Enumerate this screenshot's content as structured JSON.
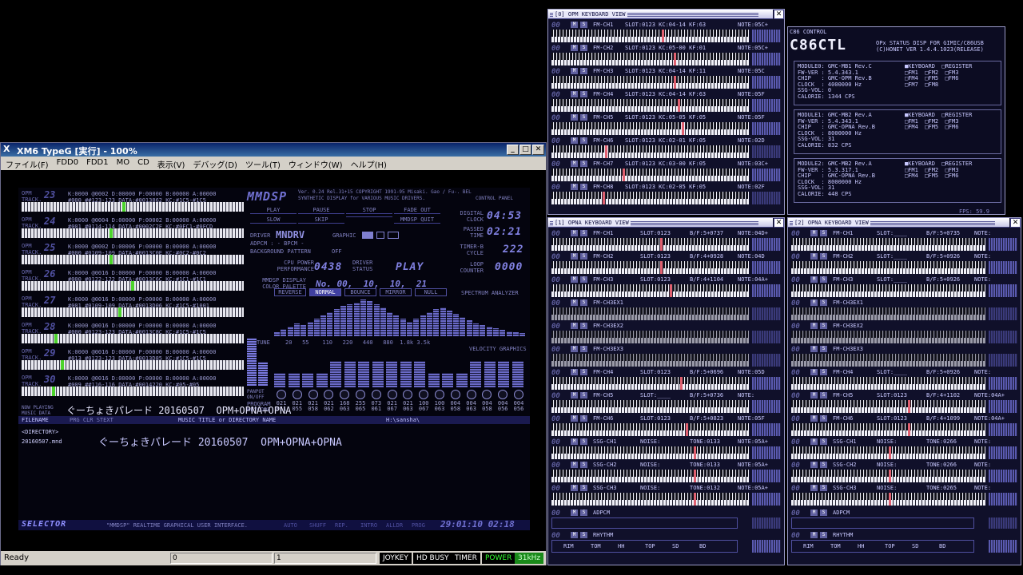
{
  "xm6": {
    "title": "XM6 TypeG [実行] - 100%",
    "logo": "Χ",
    "menu": [
      "ファイル(F)",
      "FDD0",
      "FDD1",
      "MO",
      "CD",
      "表示(V)",
      "デバッグ(D)",
      "ツール(T)",
      "ウィンドウ(W)",
      "ヘルプ(H)"
    ],
    "status": {
      "ready": "Ready",
      "fdd0": "0",
      "fdd1": "1",
      "joykey": "JOYKEY",
      "hdbusy": "HD BUSY",
      "timer": "TIMER",
      "power": "POWER",
      "clock": "31kHz"
    }
  },
  "mmdsp": {
    "logo": "MMDSP",
    "version": "Ver. 0.24 Rel.31+15 COPYRIGHT 1991-95 Misaki. Gao / Fu-. BEL",
    "subtitle": "SYNTHETIC DISPLAY for VARIOUS MUSIC DRIVERS.",
    "control_panel": "CONTROL PANEL",
    "buttons": [
      "PLAY",
      "PAUSE",
      "STOP",
      "FADE OUT",
      "SLOW",
      "SKIP",
      "",
      "MMDSP QUIT"
    ],
    "driver_label": "DRIVER",
    "driver": "MNDRV",
    "graphic": "GRAPHIC",
    "adpcm": "ADPCM : - BPCM -",
    "bg": "BACKGROUND PATTERN",
    "bg_val": "OFF",
    "cpu_label": "CPU POWER PERFORMANCE",
    "cpu": "0438",
    "status_label": "DRIVER STATUS",
    "status": "PLAY",
    "palette_label": "MMDSP DISPLAY COLOR PALETTE",
    "palette": "No. 00,  10,  10,  21",
    "digital_clock_label": "DIGITAL CLOCK",
    "digital_clock": "04:53",
    "passed_label": "PASSED TIME",
    "passed": "02:21",
    "timerb_label": "TIMER-B CYCLE",
    "timerb": "222",
    "loop_label": "LOOP COUNTER",
    "loop": "0000",
    "tracks": [
      {
        "n": "23",
        "type": "OPM",
        "info": "K:0000 @0002 D:00000 P:00000 B:00000 A:00000\n#000 ##123-123 DATA:#0013862 KC:#1C5-#1C5",
        "key": 46,
        "dim": false
      },
      {
        "n": "24",
        "type": "OPM",
        "info": "K:0000 @0004 D:00000 P:00002 B:00000 A:00000\n#001 #0114-114 DATA:#0002C2F KC:#0FC1-#0FCD",
        "key": 40,
        "dim": false
      },
      {
        "n": "25",
        "type": "OPM",
        "info": "K:0000 @0002 D:00006 P:00000 B:00000 A:00000\n#000 #0109-109 DATA:#0013C0E KC:#0C2-#0C2",
        "key": 40,
        "dim": false
      },
      {
        "n": "26",
        "type": "OPM",
        "info": "K:0000 @0016 D:00000 P:00000 B:00000 A:00000\n#000 #0122-122 DATA:#0013C6C KC:#1C1-#1C1",
        "key": 50,
        "dim": false
      },
      {
        "n": "27",
        "type": "OPM",
        "info": "K:0000 @0016 D:00000 P:00000 B:00000 A:00000\n#001 #0109-109 DATA:#0013D06 KC:#1C5-#1001",
        "key": 44,
        "dim": false
      },
      {
        "n": "28",
        "type": "OPM",
        "info": "K:0000 @0016 D:00000 P:00000 B:00000 A:00000\n#000 #0123-123 DATA:#0013C8C KC:#1C5-#1C5",
        "key": 15,
        "dim": false
      },
      {
        "n": "29",
        "type": "OPM",
        "info": "K:0000 @0016 D:00000 P:00000 B:00000 A:00000\n#013 #0123-123 DATA:#0013D85 KC:#1C5-#1C5",
        "key": 18,
        "dim": false
      },
      {
        "n": "30",
        "type": "OPM",
        "info": "K:0000 @0016 D:00000 P:00000 B:00000 A:00000\n#009 ##116-116 DATA:#0014220 KC:#05-#05",
        "key": 14,
        "dim": false
      }
    ],
    "spectrum_title": "SPECTRUM ANALYZER",
    "spec_tabs": [
      "REVERSE",
      "NORMAL",
      "BOUNCE",
      "MIRROR",
      "NULL"
    ],
    "spectrum": [
      5,
      9,
      12,
      16,
      14,
      18,
      22,
      26,
      30,
      34,
      38,
      40,
      42,
      46,
      44,
      40,
      36,
      30,
      26,
      22,
      18,
      22,
      26,
      30,
      34,
      36,
      32,
      28,
      24,
      20,
      16,
      14,
      12,
      10,
      8,
      6,
      5,
      4
    ],
    "tune_label": "TUNE",
    "tune_ticks": "20   55    110   220   440   880  1.8k 3.5k",
    "velocity_title": "VELOCITY GRAPHICS",
    "velocity": [
      40,
      40,
      40,
      40,
      75,
      75,
      75,
      75,
      75,
      75,
      75,
      40,
      40,
      40,
      75,
      75,
      75,
      75
    ],
    "panpot_label": "PANPOT ON/OFF",
    "program_label": "PROGRAM",
    "keycode_label": "KEYCODE",
    "program": [
      "021",
      "021",
      "021",
      "021",
      "168",
      "255",
      "073",
      "021",
      "021",
      "100",
      "100",
      "004",
      "004",
      "004",
      "004",
      "004"
    ],
    "keycode": [
      "051",
      "055",
      "058",
      "062",
      "063",
      "065",
      "061",
      "067",
      "063",
      "067",
      "063",
      "058",
      "063",
      "058",
      "056",
      "056"
    ],
    "now_label": "NOW PLAYING MUSIC DATA",
    "now": "ぐーちょきパレード 20160507  OPM+OPNA+OPNA",
    "sel_header": [
      "FILENAME",
      "PRG CLR STEXT",
      "MUSIC TITLE or DIRECTORY NAME",
      "H:\\sansha\\"
    ],
    "dir": "<DIRECTORY>",
    "file": "20160507.mnd",
    "file_title": "ぐーちょきパレード 20160507  OPM+OPNA+OPNA",
    "selector": "SELECTOR",
    "selector_desc": "\"MMDSP\" REALTIME GRAPHICAL USER INTERFACE.",
    "sel_flags": [
      "AUTO",
      "SHUFF",
      "REP.",
      "INTRO",
      "ALLDR",
      "PROG"
    ],
    "sel_clock": "29:01:10 02:18"
  },
  "opm_view": {
    "title": "[0] OPM KEYBOARD VIEW",
    "channels": [
      {
        "n": "00",
        "name": "FM-CH1",
        "info": "SLOT:0123 KC:04-14 KF:63",
        "note": "NOTE:05C+",
        "hl": [
          0.56
        ],
        "meter": "high"
      },
      {
        "n": "00",
        "name": "FM-CH2",
        "info": "SLOT:0123 KC:05-00 KF:01",
        "note": "NOTE:05C+",
        "hl": [
          0.62
        ],
        "meter": "high"
      },
      {
        "n": "00",
        "name": "FM-CH3",
        "info": "SLOT:0123 KC:04-14 KF:11",
        "note": "NOTE:05C",
        "hl": [
          0.62
        ],
        "meter": "high"
      },
      {
        "n": "00",
        "name": "FM-CH4",
        "info": "SLOT:0123 KC:04-14 KF:63",
        "note": "NOTE:05F",
        "hl": [
          0.64
        ],
        "meter": "high"
      },
      {
        "n": "00",
        "name": "FM-CH5",
        "info": "SLOT:0123 KC:05-05 KF:05",
        "note": "NOTE:05F",
        "hl": [
          0.66
        ],
        "meter": "high"
      },
      {
        "n": "00",
        "name": "FM-CH6",
        "info": "SLOT:0123 KC:02-01 KF:05",
        "note": "NOTE:02D",
        "hl": [
          0.27
        ],
        "meter": "low"
      },
      {
        "n": "00",
        "name": "FM-CH7",
        "info": "SLOT:0123 KC:03-00 KF:05",
        "note": "NOTE:03C+",
        "hl": [
          0.36
        ],
        "meter": "high"
      },
      {
        "n": "00",
        "name": "FM-CH8",
        "info": "SLOT:0123 KC:02-05 KF:05",
        "note": "NOTE:02F",
        "hl": [
          0.26
        ],
        "meter": "low"
      }
    ]
  },
  "opna1": {
    "title": "[1] OPNA KEYBOARD VIEW",
    "channels": [
      {
        "name": "FM-CH1",
        "info": "SLOT:0123",
        "bf": "B/F:5+0737",
        "note": "NOTE:04D+",
        "hl": [
          0.55
        ],
        "dim": false
      },
      {
        "name": "FM-CH2",
        "info": "SLOT:0123",
        "bf": "B/F:4+0928",
        "note": "NOTE:04D",
        "hl": [
          0.55
        ],
        "dim": false
      },
      {
        "name": "FM-CH3",
        "info": "SLOT:0123",
        "bf": "B/F:4+1104",
        "note": "NOTE:04A+",
        "hl": [
          0.6
        ],
        "dim": false
      },
      {
        "name": "FM-CH3EX1",
        "info": "",
        "bf": "",
        "note": "",
        "hl": [],
        "dim": true
      },
      {
        "name": "FM-CH3EX2",
        "info": "",
        "bf": "",
        "note": "",
        "hl": [],
        "dim": true
      },
      {
        "name": "FM-CH3EX3",
        "info": "",
        "bf": "",
        "note": "",
        "hl": [],
        "dim": true
      },
      {
        "name": "FM-CH4",
        "info": "SLOT:0123",
        "bf": "B/F:5+0696",
        "note": "NOTE:05D",
        "hl": [
          0.65
        ],
        "dim": false
      },
      {
        "name": "FM-CH5",
        "info": "SLOT:____",
        "bf": "B/F:5+0736",
        "note": "NOTE:",
        "hl": [],
        "dim": false
      },
      {
        "name": "FM-CH6",
        "info": "SLOT:0123",
        "bf": "B/F:5+0823",
        "note": "NOTE:05F",
        "hl": [
          0.68
        ],
        "dim": false
      },
      {
        "name": "SSG-CH1",
        "info": "NOISE:",
        "bf": "TONE:0133",
        "note": "NOTE:05A+",
        "hl": [
          0.72
        ],
        "dim": false
      },
      {
        "name": "SSG-CH2",
        "info": "NOISE:",
        "bf": "TONE:0133",
        "note": "NOTE:05A+",
        "hl": [
          0.72
        ],
        "dim": false
      },
      {
        "name": "SSG-CH3",
        "info": "NOISE:",
        "bf": "TONE:0132",
        "note": "NOTE:05A+",
        "hl": [
          0.72
        ],
        "dim": false
      }
    ],
    "adpcm": "ADPCM",
    "rhythm": "RHYTHM",
    "rhythm_items": [
      "RIM",
      "TOM",
      "HH",
      "TOP",
      "SD",
      "BD"
    ]
  },
  "opna2": {
    "title": "[2] OPNA KEYBOARD VIEW",
    "channels": [
      {
        "name": "FM-CH1",
        "info": "SLOT:____",
        "bf": "B/F:5+0735",
        "note": "NOTE:",
        "hl": [],
        "dim": false
      },
      {
        "name": "FM-CH2",
        "info": "SLOT:____",
        "bf": "B/F:5+0926",
        "note": "NOTE:",
        "hl": [],
        "dim": false
      },
      {
        "name": "FM-CH3",
        "info": "SLOT:____",
        "bf": "B/F:5+0926",
        "note": "NOTE:",
        "hl": [],
        "dim": false
      },
      {
        "name": "FM-CH3EX1",
        "info": "",
        "bf": "",
        "note": "",
        "hl": [],
        "dim": true
      },
      {
        "name": "FM-CH3EX2",
        "info": "",
        "bf": "",
        "note": "",
        "hl": [],
        "dim": true
      },
      {
        "name": "FM-CH3EX3",
        "info": "",
        "bf": "",
        "note": "",
        "hl": [],
        "dim": true
      },
      {
        "name": "FM-CH4",
        "info": "SLOT:____",
        "bf": "B/F:5+0926",
        "note": "NOTE:",
        "hl": [],
        "dim": false
      },
      {
        "name": "FM-CH5",
        "info": "SLOT:0123",
        "bf": "B/F:4+1102",
        "note": "NOTE:04A+",
        "hl": [
          0.6
        ],
        "dim": false
      },
      {
        "name": "FM-CH6",
        "info": "SLOT:0123",
        "bf": "B/F:4+1099",
        "note": "NOTE:04A+",
        "hl": [
          0.6
        ],
        "dim": false
      },
      {
        "name": "SSG-CH1",
        "info": "NOISE:",
        "bf": "TONE:0266",
        "note": "NOTE:",
        "hl": [
          0.5
        ],
        "dim": false
      },
      {
        "name": "SSG-CH2",
        "info": "NOISE:",
        "bf": "TONE:0266",
        "note": "NOTE:",
        "hl": [
          0.5
        ],
        "dim": false
      },
      {
        "name": "SSG-CH3",
        "info": "NOISE:",
        "bf": "TONE:0265",
        "note": "NOTE:",
        "hl": [
          0.5
        ],
        "dim": false
      }
    ],
    "adpcm": "ADPCM",
    "rhythm": "RHYTHM",
    "rhythm_items": [
      "RIM",
      "TOM",
      "HH",
      "TOP",
      "SD",
      "BD"
    ]
  },
  "c86": {
    "title": "C86 CONTROL",
    "logo": "C86CTL",
    "desc": "OPx STATUS DISP FOR GIMIC/C86USB\n(C)HONET VER 1.4.4.1023(RELEASE)",
    "modules": [
      {
        "info": "MODULE0: GMC-MB1 Rev.C\nFW-VER : 5.4.343.1\nCHIP   : GMC-OPM Rev.B\nCLOCK  : 4000000 Hz\nSSG-VOL: 0\nCALORIE: 1344 CPS",
        "checks": "■KEYBOARD  □REGISTER\n□FM1  □FM2  □FM3\n□FM4  □FM5  □FM6\n□FM7  □FM8"
      },
      {
        "info": "MODULE1: GMC-MB2 Rev.A\nFW-VER : 5.4.343.1\nCHIP   : GMC-OPNA Rev.B\nCLOCK  : 8000000 Hz\nSSG-VOL: 31\nCALORIE: 832 CPS",
        "checks": "■KEYBOARD  □REGISTER\n□FM1  □FM2  □FM3\n□FM4  □FM5  □FM6"
      },
      {
        "info": "MODULE2: GMC-MB2 Rev.A\nFW-VER : 5.3.317.1\nCHIP   : GMC-OPNA Rev.B\nCLOCK  : 8000000 Hz\nSSG-VOL: 31\nCALORIE: 448 CPS",
        "checks": "■KEYBOARD  □REGISTER\n□FM1  □FM2  □FM3\n□FM4  □FM5  □FM6"
      }
    ],
    "fps": "FPS: 59.9"
  }
}
